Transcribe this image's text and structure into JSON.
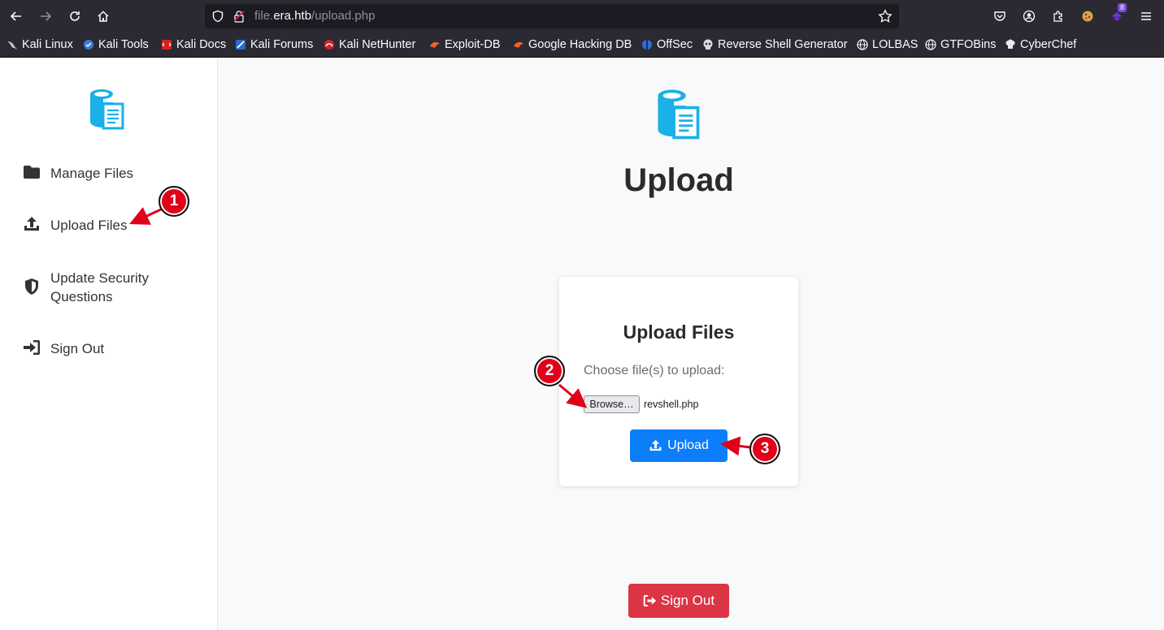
{
  "browser": {
    "url_prefix": "file.",
    "url_domain": "era.htb",
    "url_path": "/upload.php",
    "badge_count": "8",
    "bookmarks": [
      {
        "label": "Kali Linux",
        "icon": "kali-dragon-icon"
      },
      {
        "label": "Kali Tools",
        "icon": "kali-tools-icon"
      },
      {
        "label": "Kali Docs",
        "icon": "kali-docs-icon"
      },
      {
        "label": "Kali Forums",
        "icon": "kali-forums-icon"
      },
      {
        "label": "Kali NetHunter",
        "icon": "nethunter-icon"
      },
      {
        "label": "Exploit-DB",
        "icon": "exploitdb-icon"
      },
      {
        "label": "Google Hacking DB",
        "icon": "ghdb-icon"
      },
      {
        "label": "OffSec",
        "icon": "offsec-icon"
      },
      {
        "label": "Reverse Shell Generator",
        "icon": "skull-icon"
      },
      {
        "label": "LOLBAS",
        "icon": "globe-icon"
      },
      {
        "label": "GTFOBins",
        "icon": "globe-icon"
      },
      {
        "label": "CyberChef",
        "icon": "chef-hat-icon"
      }
    ]
  },
  "sidebar": {
    "items": [
      {
        "label": "Manage Files",
        "icon": "folder-icon"
      },
      {
        "label": "Upload Files",
        "icon": "upload-icon"
      },
      {
        "label": "Update Security Questions",
        "icon": "shield-icon"
      },
      {
        "label": "Sign Out",
        "icon": "sign-in-icon"
      }
    ]
  },
  "main": {
    "title": "Upload",
    "card": {
      "title": "Upload Files",
      "label": "Choose file(s) to upload:",
      "browse_label": "Browse…",
      "file_name": "revshell.php",
      "upload_label": "Upload"
    },
    "signout_label": "Sign Out"
  },
  "annotations": {
    "markers": [
      "1",
      "2",
      "3"
    ],
    "color": "#e0001a"
  },
  "colors": {
    "accent": "#0d7ef9",
    "danger": "#dc3545",
    "logo": "#1ab0e8"
  }
}
